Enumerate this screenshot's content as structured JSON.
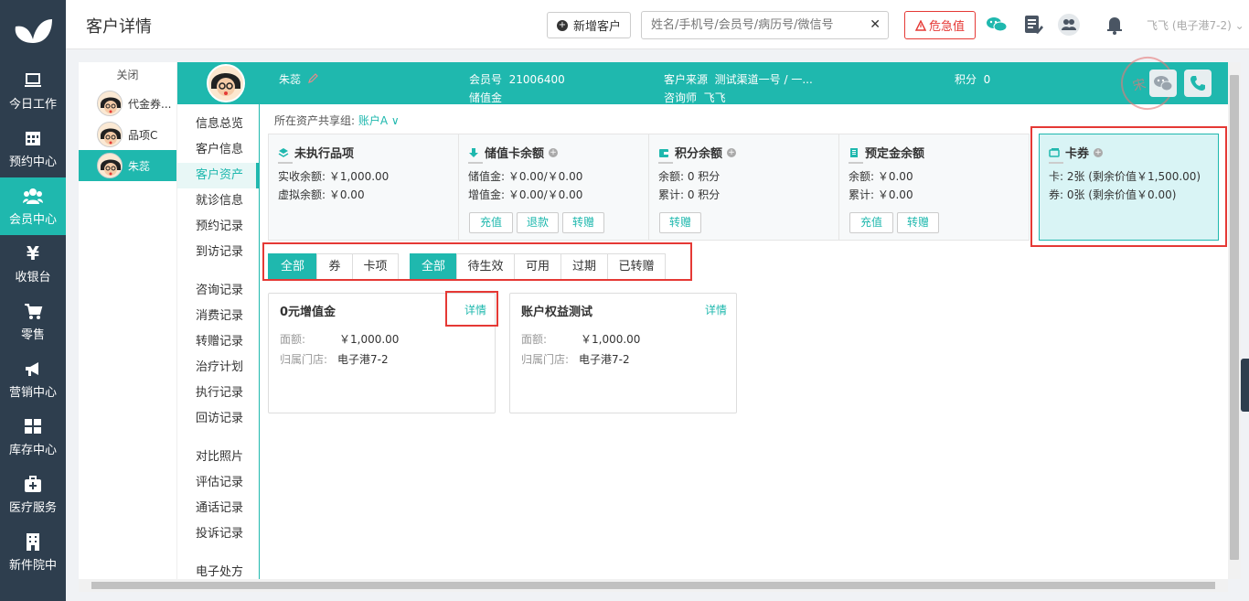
{
  "nav": {
    "items": [
      {
        "label": "今日工作",
        "icon": "laptop-icon"
      },
      {
        "label": "预约中心",
        "icon": "calendar-icon"
      },
      {
        "label": "会员中心",
        "icon": "users-icon"
      },
      {
        "label": "收银台",
        "icon": "yen-icon"
      },
      {
        "label": "零售",
        "icon": "cart-icon"
      },
      {
        "label": "营销中心",
        "icon": "megaphone-icon"
      },
      {
        "label": "库存中心",
        "icon": "grid-icon"
      },
      {
        "label": "医疗服务",
        "icon": "medkit-icon"
      },
      {
        "label": "新件院中",
        "icon": "building-icon"
      }
    ],
    "yen_glyph": "¥"
  },
  "topbar": {
    "title": "客户详情",
    "new_customer": "新增客户",
    "search_placeholder": "姓名/手机号/会员号/病历号/微信号",
    "danger_label": "危急值",
    "user": "飞飞 (电子港7-2)"
  },
  "customers": {
    "close_label": "关闭",
    "tabs": [
      {
        "name": "代金券..."
      },
      {
        "name": "品项C"
      },
      {
        "name": "朱蕊"
      }
    ]
  },
  "banner": {
    "name": "朱蕊",
    "member_no_label": "会员号",
    "member_no": "21006400",
    "stored_value": "储值金",
    "source_label": "客户来源",
    "source": "测试渠道一号 / 一...",
    "consultant_label": "咨询师",
    "consultant": "飞飞",
    "points_label": "积分",
    "points": "0",
    "stamp": "宋 倩"
  },
  "menu": {
    "group1": [
      "信息总览",
      "客户信息",
      "客户资产",
      "就诊信息",
      "预约记录",
      "到访记录"
    ],
    "group2": [
      "咨询记录",
      "消费记录",
      "转赠记录",
      "治疗计划",
      "执行记录",
      "回访记录"
    ],
    "group3": [
      "对比照片",
      "评估记录",
      "通话记录",
      "投诉记录"
    ],
    "group4": [
      "电子处方"
    ]
  },
  "assets": {
    "group_label": "所在资产共享组:",
    "group_value": "账户A ∨",
    "cards": [
      {
        "title": "未执行品项",
        "lines": [
          "实收余额: ￥1,000.00",
          "虚拟余额: ￥0.00"
        ],
        "buttons": []
      },
      {
        "title": "储值卡余额",
        "lines": [
          "储值金: ￥0.00/￥0.00",
          "增值金: ￥0.00/￥0.00"
        ],
        "buttons": [
          "充值",
          "退款",
          "转赠"
        ]
      },
      {
        "title": "积分余额",
        "lines": [
          "余额: 0 积分",
          "累计: 0 积分"
        ],
        "buttons": [
          "转赠"
        ]
      },
      {
        "title": "预定金余额",
        "lines": [
          "余额: ￥0.00",
          "累计: ￥0.00"
        ],
        "buttons": [
          "充值",
          "转赠"
        ]
      },
      {
        "title": "卡券",
        "lines": [
          "卡: 2张 (剩余价值￥1,500.00)",
          "券: 0张 (剩余价值￥0.00)"
        ],
        "buttons": []
      }
    ]
  },
  "filters": {
    "type": [
      "全部",
      "券",
      "卡项"
    ],
    "status": [
      "全部",
      "待生效",
      "可用",
      "过期",
      "已转赠"
    ]
  },
  "vouchers": [
    {
      "title": "0元增值金",
      "detail": "详情",
      "face_label": "面额:",
      "face": "￥1,000.00",
      "store_label": "归属门店:",
      "store": "电子港7-2"
    },
    {
      "title": "账户权益测试",
      "detail": "详情",
      "face_label": "面额:",
      "face": "￥1,000.00",
      "store_label": "归属门店:",
      "store": "电子港7-2"
    }
  ],
  "colors": {
    "accent": "#1fb8ae",
    "nav_bg": "#2e3e4e",
    "highlight": "#e53935"
  }
}
